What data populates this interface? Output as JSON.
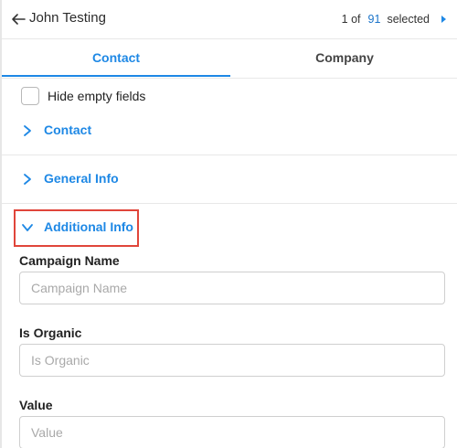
{
  "header": {
    "contact_name": "John Testing",
    "counter_prefix": "1 of",
    "counter_total": "91",
    "counter_suffix": "selected"
  },
  "tabs": [
    {
      "label": "Contact",
      "active": true
    },
    {
      "label": "Company",
      "active": false
    }
  ],
  "hide_empty": {
    "label": "Hide empty fields",
    "checked": false
  },
  "sections": [
    {
      "label": "Contact",
      "expanded": false
    },
    {
      "label": "General Info",
      "expanded": false
    },
    {
      "label": "Additional Info",
      "expanded": true
    }
  ],
  "fields": [
    {
      "label": "Campaign Name",
      "value": "",
      "placeholder": "Campaign Name"
    },
    {
      "label": "Is Organic",
      "value": "",
      "placeholder": "Is Organic"
    },
    {
      "label": "Value",
      "value": "",
      "placeholder": "Value"
    }
  ],
  "colors": {
    "accent": "#1e88e5",
    "highlight": "#e0453a",
    "counter_total": "#1a73c9"
  },
  "icons": {
    "back": "arrow-left-icon",
    "next": "caret-right-icon",
    "collapsed": "chevron-right-icon",
    "expanded": "chevron-down-icon"
  }
}
